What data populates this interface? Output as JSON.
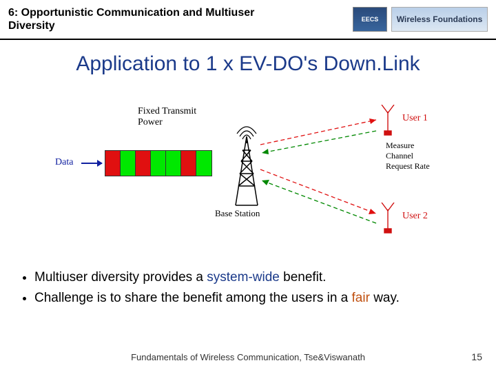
{
  "header": {
    "chapter": "6: Opportunistic Communication and Multiuser Diversity",
    "logo_eecs": "EECS",
    "logo_wf": "Wireless Foundations"
  },
  "title": "Application to 1 x EV-DO's  Down.Link",
  "diagram": {
    "fixed_transmit_power": "Fixed Transmit\nPower",
    "data_label": "Data",
    "base_station": "Base Station",
    "user1": "User 1",
    "user2": "User 2",
    "mcr": "Measure Channel\nRequest Rate",
    "block_colors": [
      "r",
      "g",
      "r",
      "g",
      "g",
      "r",
      "g"
    ]
  },
  "bullets": [
    {
      "pre": "Multiuser diversity provides a ",
      "hl": "system-wide",
      "post": " benefit.",
      "hl_class": "sys"
    },
    {
      "pre": "Challenge is to share the benefit among the users in a ",
      "hl": "fair",
      "post": " way.",
      "hl_class": "fair"
    }
  ],
  "footer": "Fundamentals of Wireless Communication, Tse&Viswanath",
  "page": "15"
}
